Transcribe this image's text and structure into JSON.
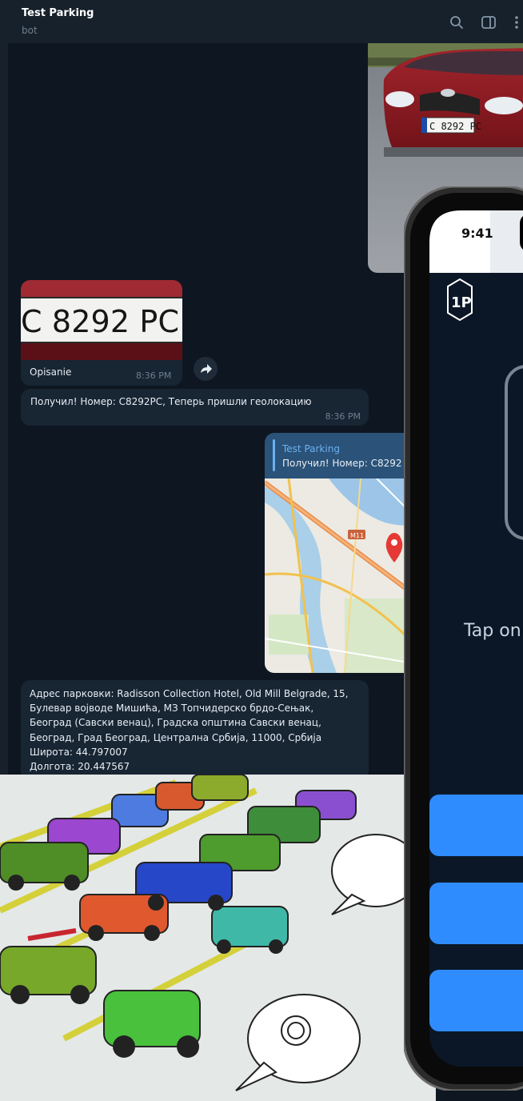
{
  "header": {
    "title": "Test Parking",
    "subtitle": "bot",
    "icons": [
      "search-icon",
      "sidebar-toggle-icon",
      "more-icon"
    ]
  },
  "car_photo": {
    "plate_text": "C 8292 PC"
  },
  "plate_message": {
    "plate_text": "C 8292 PC",
    "caption": "Opisanie",
    "time": "8:36 PM"
  },
  "message1": {
    "text": "Получил! Номер: C8292PC, Теперь пришли геолокацию",
    "time": "8:36 PM"
  },
  "location_message": {
    "reply_name": "Test Parking",
    "reply_text": "Получил! Номер: C8292",
    "map_label": "M11"
  },
  "address_message": {
    "lines": [
      "Адрес парковки: Radisson Collection Hotel, Old Mill Belgrade, 15,",
      "Булевар војводе Мишића, МЗ Топчидерско брдо-Сењак,",
      "Београд (Савски венац), Градска општина Савски венац,",
      "Београд, Град Београд, Централна Србија, 11000, Србија",
      "Широта: 44.797007",
      "Долгота: 20.447567"
    ]
  },
  "phone": {
    "time": "9:41",
    "tap_text": "Tap on",
    "logo": "ParkingLogo-icon"
  },
  "colors": {
    "background": "#0e1621",
    "header": "#17212b",
    "incoming_bubble": "#182533",
    "outgoing_bubble": "#2b5278",
    "accent": "#6ab2f2",
    "phone_button": "#2f8cff"
  }
}
